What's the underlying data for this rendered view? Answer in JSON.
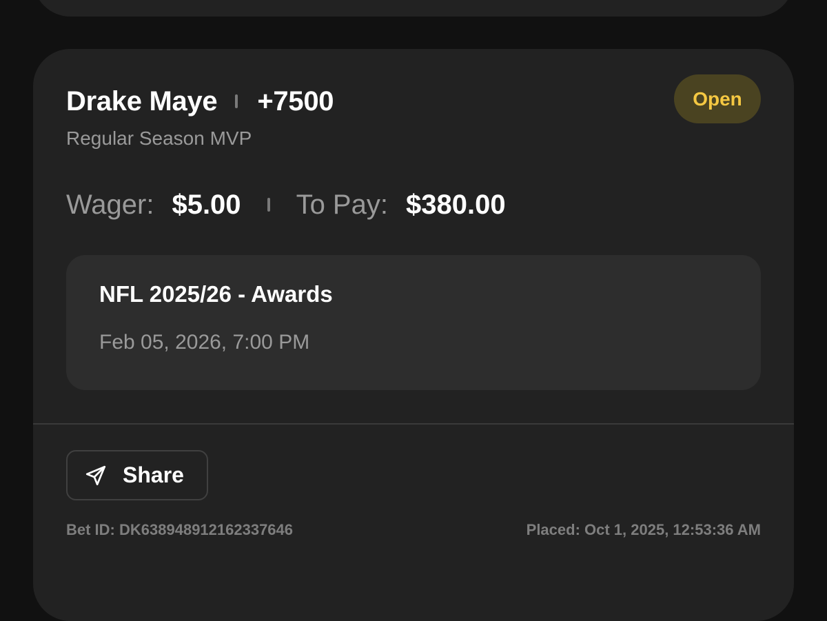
{
  "bet": {
    "selection": "Drake Maye",
    "odds": "+7500",
    "market": "Regular Season MVP",
    "status": "Open",
    "wager_label": "Wager:",
    "wager_value": "$5.00",
    "to_pay_label": "To Pay:",
    "to_pay_value": "$380.00",
    "event_name": "NFL 2025/26 - Awards",
    "event_date": "Feb 05, 2026, 7:00 PM",
    "share_label": "Share",
    "share_icon": "send-icon",
    "bet_id": "Bet ID: DK638948912162337646",
    "placed": "Placed: Oct 1, 2025, 12:53:36 AM"
  },
  "colors": {
    "background": "#111111",
    "card": "#222222",
    "event_box": "#2d2d2d",
    "status_text": "#f5c842",
    "status_bg": "#4a4321"
  }
}
